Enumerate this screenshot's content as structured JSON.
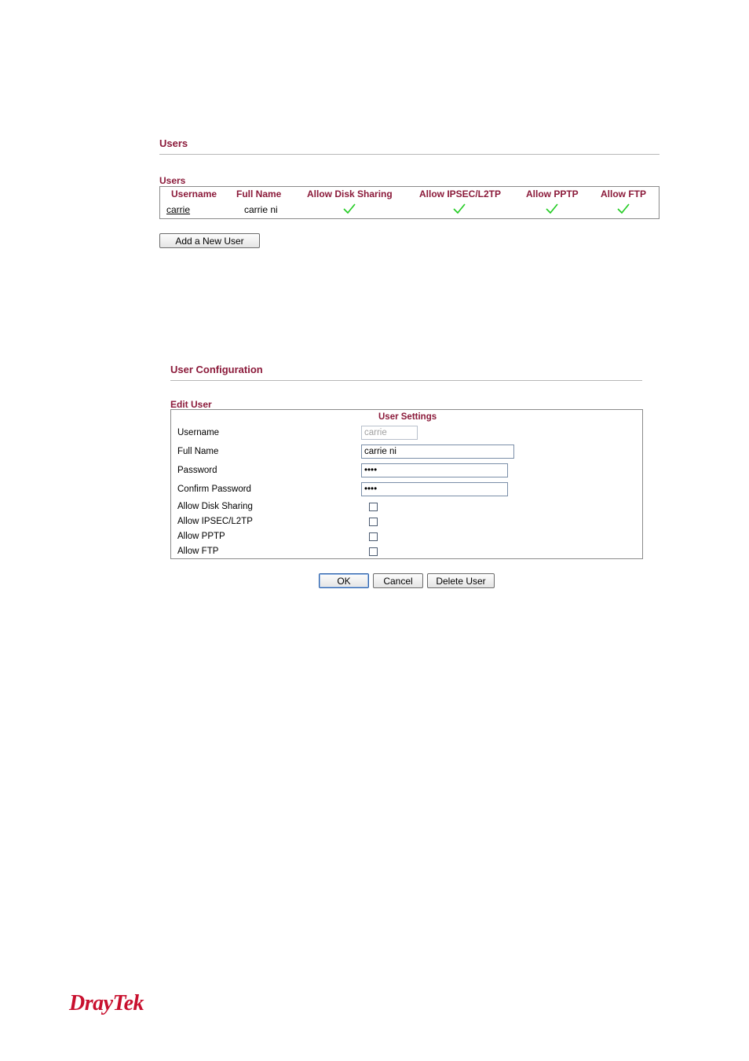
{
  "users_panel": {
    "title": "Users",
    "section_label": "Users",
    "columns": [
      "Username",
      "Full Name",
      "Allow Disk Sharing",
      "Allow IPSEC/L2TP",
      "Allow PPTP",
      "Allow FTP"
    ],
    "rows": [
      {
        "username": "carrie",
        "full_name": "carrie ni",
        "allow_disk_sharing": true,
        "allow_ipsec_l2tp": true,
        "allow_pptp": true,
        "allow_ftp": true
      }
    ],
    "add_button_label": "Add a New User"
  },
  "config_panel": {
    "title": "User Configuration",
    "section_label": "Edit User",
    "settings_header": "User Settings",
    "fields": {
      "username_label": "Username",
      "username_value": "carrie",
      "full_name_label": "Full Name",
      "full_name_value": "carrie ni",
      "password_label": "Password",
      "password_value": "1234",
      "confirm_password_label": "Confirm Password",
      "confirm_password_value": "1234"
    },
    "checkboxes": [
      {
        "label": "Allow Disk Sharing",
        "checked": false
      },
      {
        "label": "Allow IPSEC/L2TP",
        "checked": false
      },
      {
        "label": "Allow PPTP",
        "checked": false
      },
      {
        "label": "Allow FTP",
        "checked": false
      }
    ],
    "buttons": {
      "ok": "OK",
      "cancel": "Cancel",
      "delete": "Delete User"
    }
  },
  "logo": {
    "text": "DrayTek"
  },
  "colors": {
    "accent": "#8b1a3a",
    "check": "#22cc22",
    "logo": "#c8102e"
  },
  "icons": {
    "check": "check-mark-icon"
  }
}
